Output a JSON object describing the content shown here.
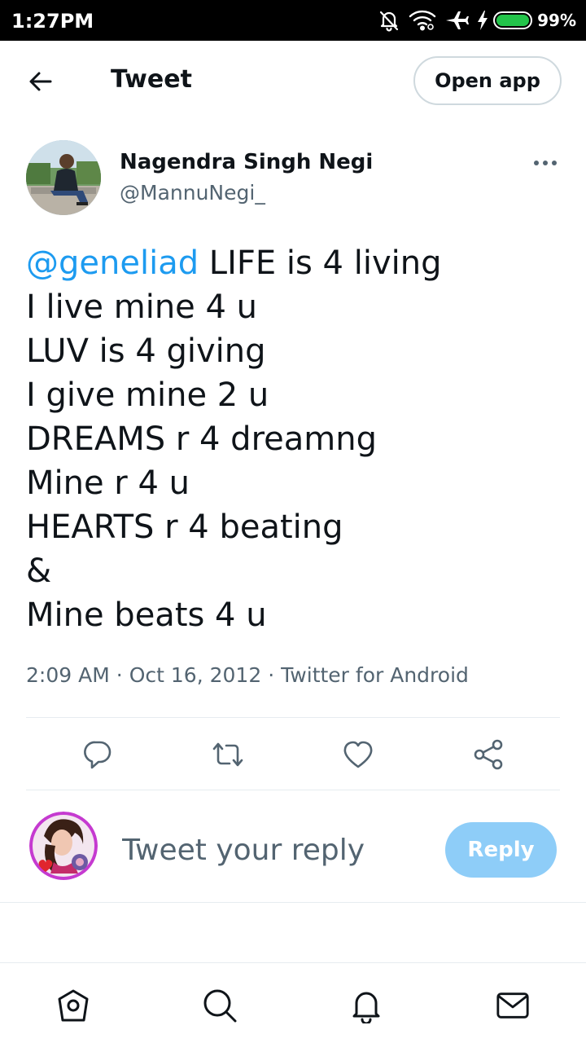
{
  "status_bar": {
    "time": "1:27PM",
    "battery_percent": "99%",
    "battery_level": 0.99,
    "icons": [
      "mute-icon",
      "wifi-icon",
      "airplane-icon",
      "charging-icon",
      "battery-icon"
    ]
  },
  "header": {
    "title": "Tweet",
    "back_icon": "arrow-left-icon",
    "open_app_label": "Open app"
  },
  "tweet": {
    "author_name": "Nagendra Singh Negi",
    "author_handle": "@MannuNegi_",
    "more_icon": "more-horizontal-icon",
    "mention": "@geneliad",
    "first_line_rest": " LIFE is 4 living",
    "lines": [
      "I live mine 4 u",
      "LUV is 4 giving",
      "I give mine 2 u",
      "DREAMS r 4 dreamng",
      "Mine r 4 u",
      "HEARTS r 4 beating",
      "&",
      "Mine beats 4 u"
    ],
    "time": "2:09 AM",
    "date": "Oct 16, 2012",
    "source": "Twitter for Android",
    "separator": "·"
  },
  "actions": {
    "icons": [
      "reply-icon",
      "retweet-icon",
      "like-icon",
      "share-icon"
    ]
  },
  "reply": {
    "placeholder": "Tweet your reply",
    "button_label": "Reply"
  },
  "bottom_nav": {
    "icons": [
      "home-icon",
      "search-icon",
      "notifications-icon",
      "messages-icon"
    ]
  },
  "colors": {
    "link": "#1d9bf0",
    "secondary_text": "#536471",
    "reply_button": "#8ecdf8",
    "divider": "#e6ecf0"
  }
}
